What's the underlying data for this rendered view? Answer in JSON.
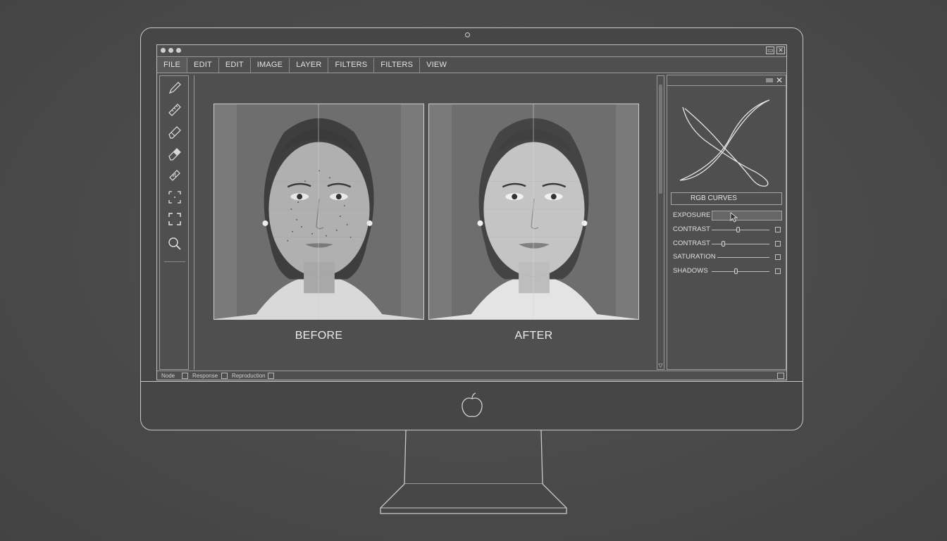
{
  "menu": {
    "items": [
      {
        "label": "FILE"
      },
      {
        "label": "EDIT"
      },
      {
        "label": "EDIT"
      },
      {
        "label": "IMAGE"
      },
      {
        "label": "LAYER"
      },
      {
        "label": "FILTERS"
      },
      {
        "label": "FILTERS"
      },
      {
        "label": "VIEW"
      }
    ]
  },
  "tools": [
    "pencil-icon",
    "ruler-icon",
    "eraser-icon",
    "eraser-alt-icon",
    "healing-bandage-icon",
    "marquee-select-icon",
    "crop-frame-icon",
    "zoom-icon"
  ],
  "photos": {
    "before_label": "BEFORE",
    "after_label": "AFTER"
  },
  "panel": {
    "curves_label": "RGB CURVES",
    "adjustments": [
      {
        "label": "EXPOSURE",
        "value": null
      },
      {
        "label": "CONTRAST",
        "value": 0.45
      },
      {
        "label": "CONTRAST",
        "value": 0.18
      },
      {
        "label": "SATURATION",
        "value": null
      },
      {
        "label": "SHADOWS",
        "value": 0.42
      }
    ]
  },
  "status": {
    "item1": "Node",
    "item2": "Response",
    "item3": "Reproduction"
  },
  "colors": {
    "background": "#4a4a4a",
    "line": "#c9c9c9",
    "photo_bg": "#6c6c6c"
  }
}
